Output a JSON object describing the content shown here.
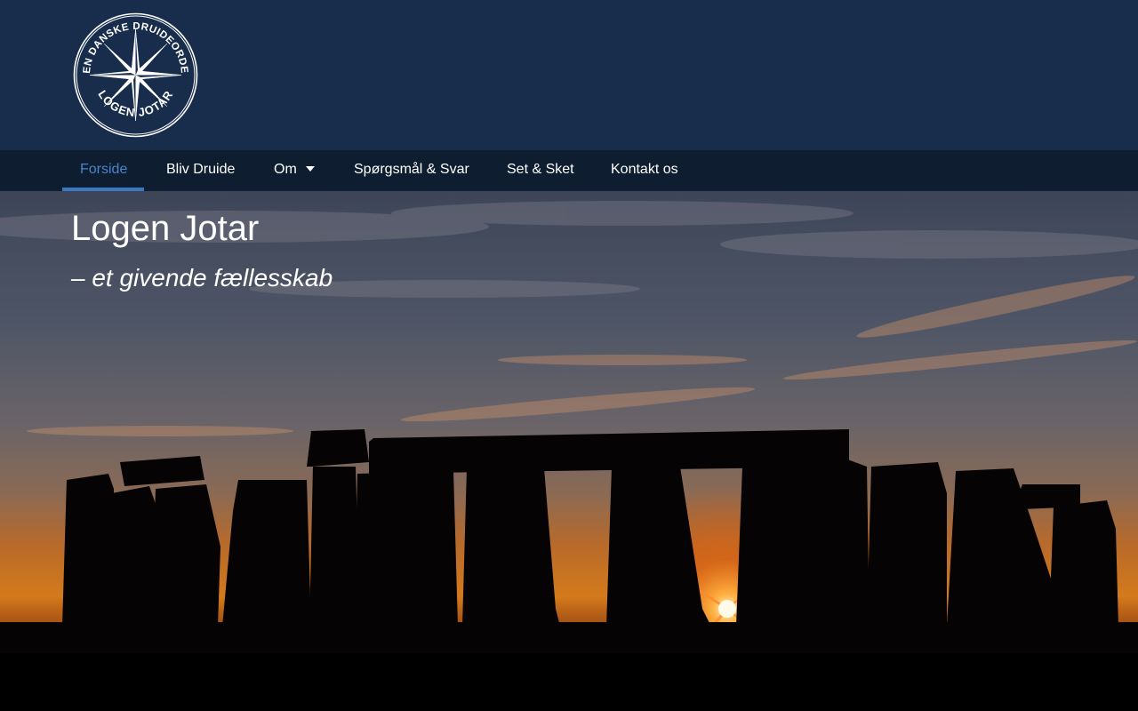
{
  "header": {
    "logo": {
      "top_text": "DEN DANSKE DRUIDEORDEN",
      "bottom_text": "LOGEN JOTAR",
      "icon": "compass-star-icon"
    }
  },
  "nav": {
    "items": [
      {
        "label": "Forside",
        "active": true
      },
      {
        "label": "Bliv Druide"
      },
      {
        "label": "Om",
        "has_dropdown": true
      },
      {
        "label": "Spørgsmål & Svar"
      },
      {
        "label": "Set & Sket"
      },
      {
        "label": "Kontakt os"
      }
    ]
  },
  "hero": {
    "title": "Logen Jotar",
    "subtitle": "– et givende fællesskab",
    "background": "stonehenge-sunset-photo"
  },
  "colors": {
    "header_bg": "#182d4c",
    "nav_bg": "#0e1e30",
    "active": "#4a84c8",
    "text": "#ffffff"
  }
}
